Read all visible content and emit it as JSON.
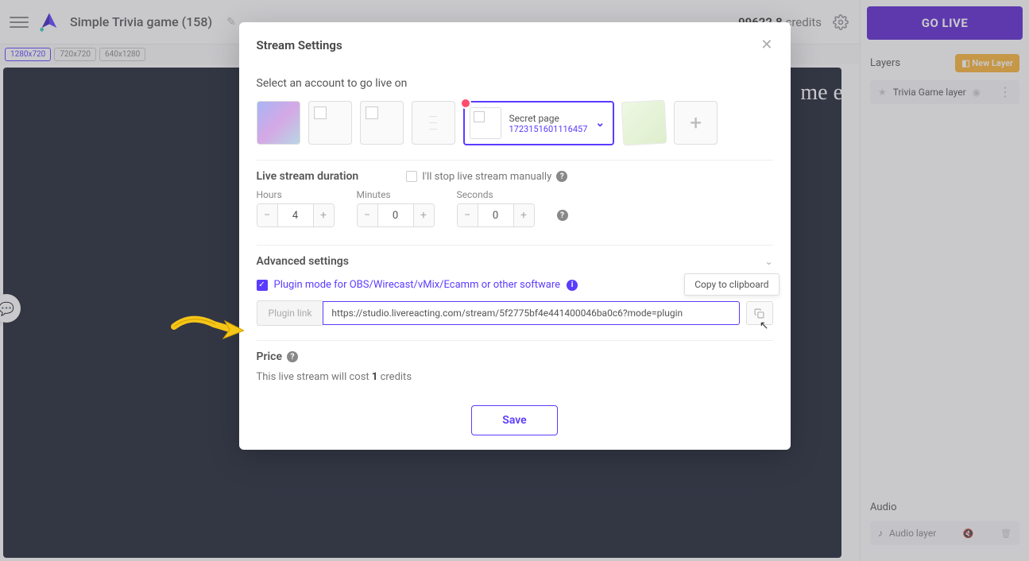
{
  "topbar": {
    "project_title": "Simple Trivia game (158)",
    "credits_value": "99622.8",
    "credits_label": "credits"
  },
  "size_tabs": [
    "1280x720",
    "720x720",
    "640x1280"
  ],
  "go_live_label": "GO LIVE",
  "layers": {
    "header": "Layers",
    "new_layer_label": "New Layer",
    "items": [
      {
        "name": "Trivia Game layer"
      }
    ]
  },
  "audio": {
    "header": "Audio",
    "items": [
      {
        "name": "Audio layer"
      }
    ]
  },
  "canvas_visible_text": "me end",
  "modal": {
    "title": "Stream Settings",
    "select_account_label": "Select an account to go live on",
    "selected_account": {
      "name": "Secret page",
      "id": "1723151601116457"
    },
    "add_tile_symbol": "+",
    "duration_label": "Live stream duration",
    "manual_stop_label": "I'll stop live stream manually",
    "hours_label": "Hours",
    "minutes_label": "Minutes",
    "seconds_label": "Seconds",
    "hours_value": "4",
    "minutes_value": "0",
    "seconds_value": "0",
    "advanced_label": "Advanced settings",
    "plugin_mode_label": "Plugin mode for OBS/Wirecast/vMix/Ecamm or other software",
    "plugin_link_label": "Plugin link",
    "plugin_link_value": "https://studio.livereacting.com/stream/5f2775bf4e441400046ba0c6?mode=plugin",
    "copy_tooltip": "Copy to clipboard",
    "price_label": "Price",
    "price_text_prefix": "This live stream will cost ",
    "price_credits": "1",
    "price_text_suffix": " credits",
    "save_label": "Save"
  }
}
